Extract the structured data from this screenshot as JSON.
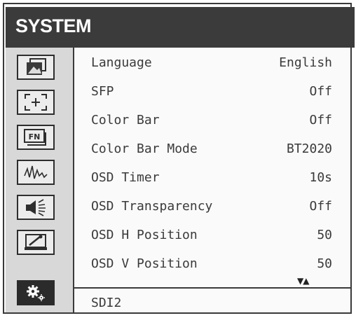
{
  "header": {
    "title": "SYSTEM"
  },
  "sidebar": {
    "items": [
      {
        "icon": "picture-icon",
        "active": false
      },
      {
        "icon": "marker-focus-icon",
        "active": false
      },
      {
        "icon": "function-key-icon",
        "active": false
      },
      {
        "icon": "waveform-icon",
        "active": false
      },
      {
        "icon": "speaker-icon",
        "active": false
      },
      {
        "icon": "monitor-tools-icon",
        "active": false
      },
      {
        "icon": "gear-icon",
        "active": true
      }
    ]
  },
  "menu": {
    "items": [
      {
        "label": "Language",
        "value": "English"
      },
      {
        "label": "SFP",
        "value": "Off"
      },
      {
        "label": "Color Bar",
        "value": "Off"
      },
      {
        "label": "Color Bar Mode",
        "value": "BT2020"
      },
      {
        "label": "OSD Timer",
        "value": "10s"
      },
      {
        "label": "OSD Transparency",
        "value": "Off"
      },
      {
        "label": "OSD H Position",
        "value": "50"
      },
      {
        "label": "OSD V Position",
        "value": "50"
      }
    ],
    "scroll_indicator": "▼▲"
  },
  "footer": {
    "input_label": "SDI2"
  },
  "colors": {
    "header_bg": "#3b3b3b",
    "sidebar_bg": "#d8d8d8",
    "text": "#3a3a3a"
  }
}
